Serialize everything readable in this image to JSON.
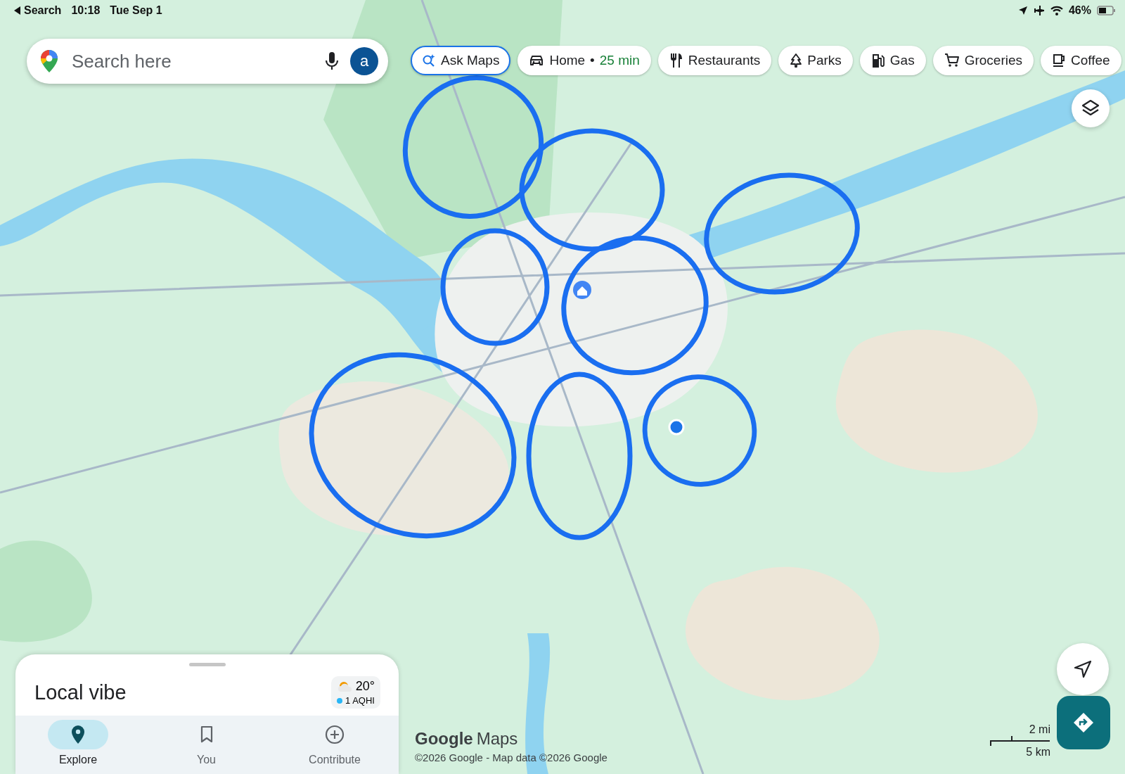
{
  "status_bar": {
    "back": "Search",
    "time": "10:18",
    "date": "Tue Sep 1",
    "battery": "46%"
  },
  "search": {
    "placeholder": "Search here",
    "avatar": "a"
  },
  "chips": [
    {
      "kind": "ask",
      "label": "Ask Maps"
    },
    {
      "kind": "car",
      "label": "Home",
      "separator": "•",
      "detail": "25 min"
    },
    {
      "kind": "fork",
      "label": "Restaurants"
    },
    {
      "kind": "tree",
      "label": "Parks"
    },
    {
      "kind": "fuel",
      "label": "Gas"
    },
    {
      "kind": "cart",
      "label": "Groceries"
    },
    {
      "kind": "cup",
      "label": "Coffee"
    }
  ],
  "sheet": {
    "title": "Local vibe",
    "temperature": "20°",
    "air_quality": "1 AQHI"
  },
  "nav": [
    {
      "kind": "pin",
      "label": "Explore",
      "selected": true
    },
    {
      "kind": "bookmark",
      "label": "You",
      "selected": false
    },
    {
      "kind": "plus",
      "label": "Contribute",
      "selected": false
    }
  ],
  "attribution": {
    "brand": "Google",
    "product": "Maps",
    "copyright": "©2026 Google - Map data ©2026 Google"
  },
  "scale": {
    "imperial": "2 mi",
    "metric": "5 km"
  }
}
